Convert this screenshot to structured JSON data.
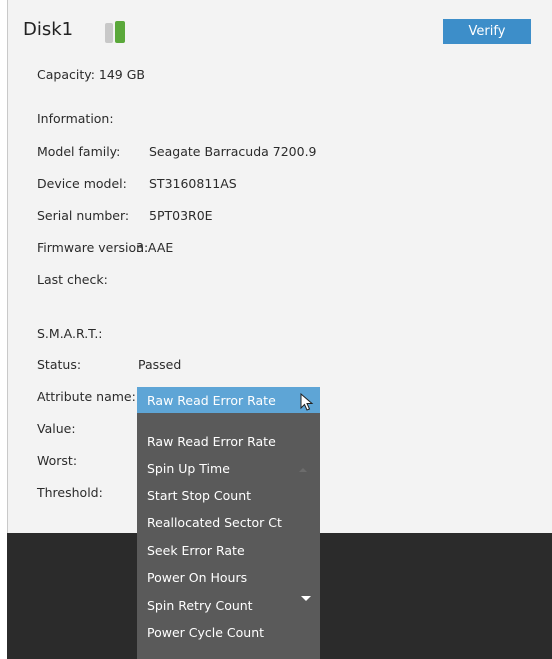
{
  "disk": {
    "title": "Disk1",
    "verify_label": "Verify",
    "capacity": "Capacity: 149 GB"
  },
  "info": {
    "heading": "Information:",
    "model_family_label": "Model family:",
    "model_family_value": "Seagate Barracuda 7200.9",
    "device_model_label": "Device model:",
    "device_model_value": "ST3160811AS",
    "serial_label": "Serial number:",
    "serial_value": "5PT03R0E",
    "firmware_label": "Firmware version:",
    "firmware_value": "3.AAE",
    "last_check_label": "Last check:"
  },
  "smart": {
    "heading": "S.M.A.R.T.:",
    "status_label": "Status:",
    "status_value": "Passed",
    "attribute_label": "Attribute name:",
    "attribute_selected": "Raw Read Error Rate",
    "value_label": "Value:",
    "worst_label": "Worst:",
    "threshold_label": "Threshold:"
  },
  "dropdown": {
    "options": [
      "Raw Read Error Rate",
      "Spin Up Time",
      "Start Stop Count",
      "Reallocated Sector Ct",
      "Seek Error Rate",
      "Power On Hours",
      "Spin Retry Count",
      "Power Cycle Count"
    ]
  },
  "colors": {
    "accent": "#3d8ec9",
    "select_bg": "#5ea5d6",
    "dropdown_bg": "#5a5a5a",
    "disk_icon": "#5aa83a"
  },
  "icons": [
    "disk-icon",
    "cursor-icon",
    "scroll-up-icon",
    "scroll-down-icon"
  ]
}
